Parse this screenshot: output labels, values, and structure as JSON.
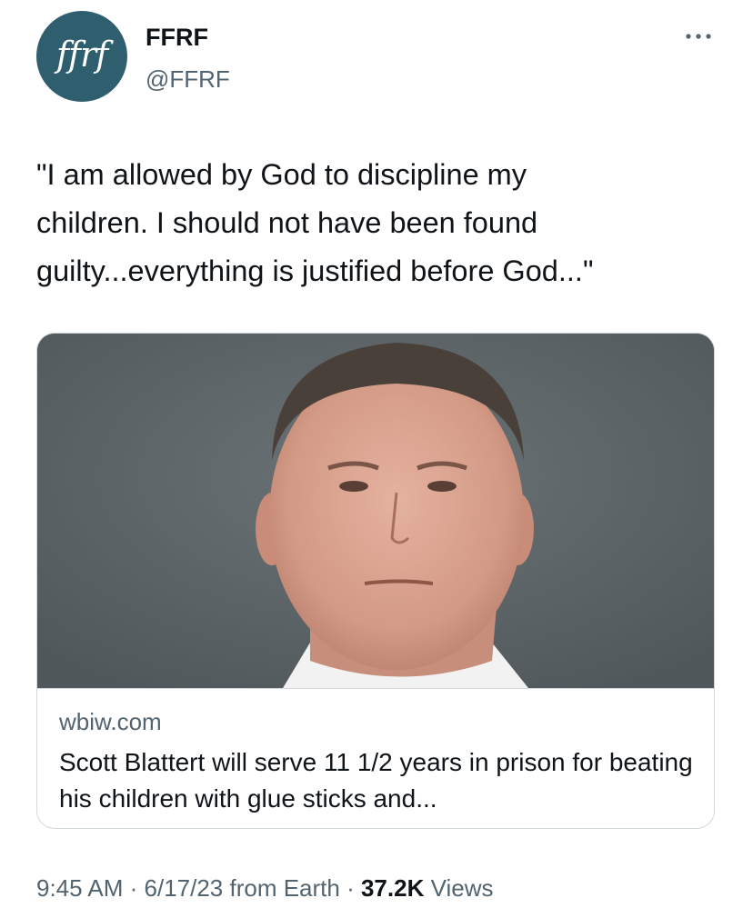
{
  "author": {
    "avatar_text": "ffrf",
    "avatar_color": "#2f5f6e",
    "display_name": "FFRF",
    "handle": "@FFRF"
  },
  "tweet": {
    "text": "\"I am allowed by God to discipline my\nchildren. I should not have been found\nguilty...everything is justified before God...\""
  },
  "link_card": {
    "domain": "wbiw.com",
    "title": "Scott Blattert will serve 11 1/2 years in prison for beating his children with glue sticks and..."
  },
  "meta": {
    "time": "9:45 AM",
    "separator1": " · ",
    "date": "6/17/23",
    "source": " from Earth",
    "separator2": " · ",
    "views_count": "37.2K",
    "views_label": " Views"
  },
  "icons": {
    "more": "more-horizontal-icon"
  },
  "colors": {
    "text_primary": "#0f1419",
    "text_secondary": "#536471",
    "border": "#cfd9de"
  }
}
